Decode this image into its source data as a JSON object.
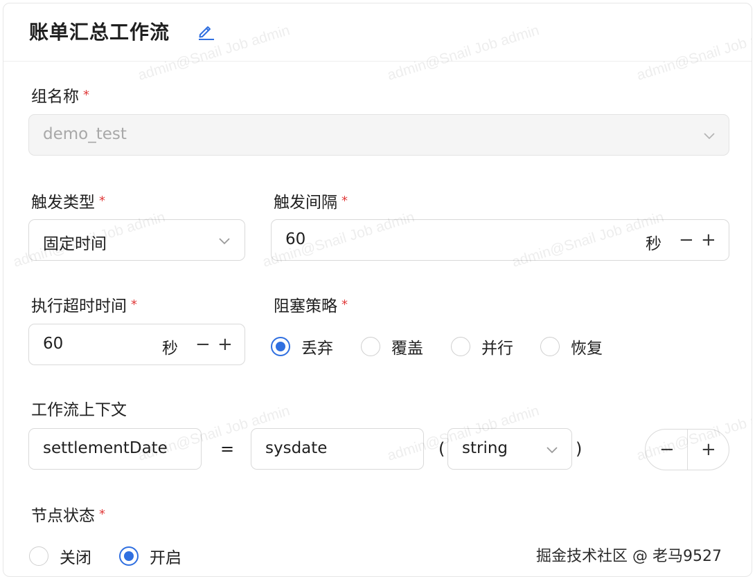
{
  "header": {
    "title": "账单汇总工作流"
  },
  "group_name": {
    "label": "组名称",
    "required_mark": "*",
    "value": "demo_test"
  },
  "trigger_type": {
    "label": "触发类型",
    "required_mark": "*",
    "value": "固定时间"
  },
  "trigger_interval": {
    "label": "触发间隔",
    "required_mark": "*",
    "value": "60",
    "unit": "秒",
    "minus": "−",
    "plus": "+"
  },
  "exec_timeout": {
    "label": "执行超时时间",
    "required_mark": "*",
    "value": "60",
    "unit": "秒",
    "minus": "−",
    "plus": "+"
  },
  "block_strategy": {
    "label": "阻塞策略",
    "required_mark": "*",
    "options": [
      "丢弃",
      "覆盖",
      "并行",
      "恢复"
    ],
    "selected": "丢弃"
  },
  "workflow_context": {
    "label": "工作流上下文",
    "key": "settlementDate",
    "equals": "=",
    "value": "sysdate",
    "open_paren": "(",
    "type": "string",
    "close_paren": ")",
    "minus": "−",
    "plus": "+"
  },
  "node_status": {
    "label": "节点状态",
    "required_mark": "*",
    "options": [
      "关闭",
      "开启"
    ],
    "selected": "开启"
  },
  "watermark": "admin@Snail Job admin",
  "credit": "掘金技术社区 @ 老马9527",
  "colors": {
    "accent": "#2f6fe0",
    "required": "#e03a3a",
    "border": "#d9d9d9"
  }
}
